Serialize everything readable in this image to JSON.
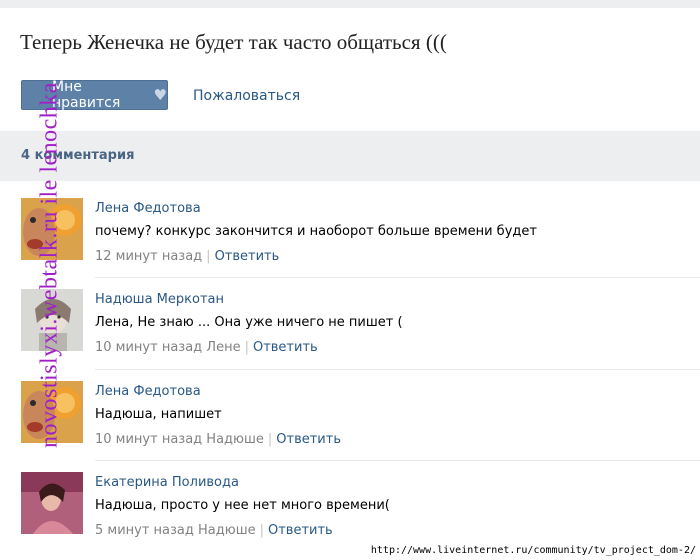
{
  "post": {
    "title": "Теперь Женечка не будет так часто общаться (((",
    "like_label": "Мне нравится",
    "report_label": "Пожаловаться"
  },
  "comments_header": {
    "count_label": "4 комментария"
  },
  "comments": [
    {
      "author": "Лена Федотова",
      "text": "почему? конкурс закончится и наоборот больше времени будет",
      "time": "12 минут назад",
      "reply_label": "Ответить",
      "avatar": "avatar-orange-face"
    },
    {
      "author": "Надюша Меркотан",
      "text": "Лена, Не знаю ... Она уже ничего не пишет (",
      "time": "10 минут назад Лене",
      "reply_label": "Ответить",
      "avatar": "avatar-pale-portrait"
    },
    {
      "author": "Лена Федотова",
      "text": "Надюша, напишет",
      "time": "10 минут назад Надюше",
      "reply_label": "Ответить",
      "avatar": "avatar-orange-face"
    },
    {
      "author": "Екатерина Поливода",
      "text": "Надюша, просто у нее нет много времени(",
      "time": "5 минут назад Надюше",
      "reply_label": "Ответить",
      "avatar": "avatar-pink-portrait"
    }
  ],
  "watermark": {
    "text": "novostislyxi.webtalk.ru ile lenochka",
    "color": "#a020c8"
  },
  "status_url": "http://www.liveinternet.ru/community/tv_project_dom-2/",
  "colors": {
    "link": "#2a5885",
    "button": "#5e81a8",
    "band": "#edeef0"
  }
}
